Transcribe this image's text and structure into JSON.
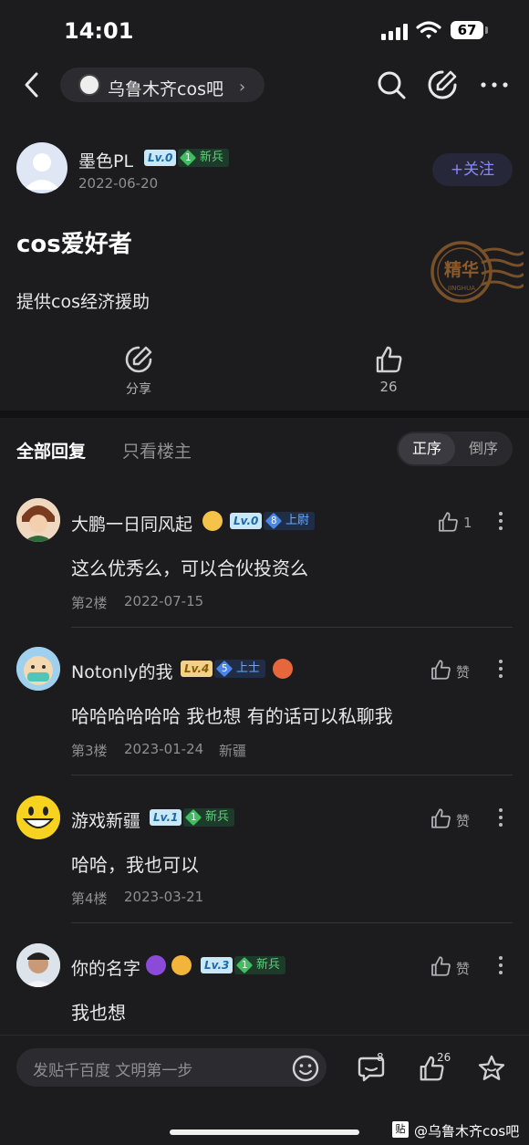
{
  "status_bar": {
    "time": "14:01",
    "battery": "67"
  },
  "nav": {
    "forum_name": "乌鲁木齐cos吧",
    "chevron": "›"
  },
  "post": {
    "author": "墨色PL",
    "level": "Lv.0",
    "rank_num": "1",
    "rank": "新兵",
    "date": "2022-06-20",
    "follow_label": "+关注",
    "title": "cos爱好者",
    "body": "提供cos经济援助",
    "stamp_text": "精华",
    "stamp_sub": "JINGHUA",
    "share_label": "分享",
    "like_count": "26"
  },
  "tabs": {
    "all": "全部回复",
    "op_only": "只看楼主",
    "asc": "正序",
    "desc": "倒序"
  },
  "comments": [
    {
      "name": "大鹏一日同风起",
      "level": "Lv.0",
      "rank_num": "8",
      "rank": "上尉",
      "text": "这么优秀么，可以合伙投资么",
      "floor": "第2楼",
      "date": "2022-07-15",
      "location": "",
      "likes": "1"
    },
    {
      "name": "Notonly的我",
      "level": "Lv.4",
      "rank_num": "5",
      "rank": "上士",
      "text": "哈哈哈哈哈哈 我也想 有的话可以私聊我",
      "floor": "第3楼",
      "date": "2023-01-24",
      "location": "新疆",
      "likes": "赞"
    },
    {
      "name": "游戏新疆",
      "level": "Lv.1",
      "rank_num": "1",
      "rank": "新兵",
      "text": "哈哈，我也可以",
      "floor": "第4楼",
      "date": "2023-03-21",
      "location": "",
      "likes": "赞"
    },
    {
      "name": "你的名字",
      "level": "Lv.3",
      "rank_num": "1",
      "rank": "新兵",
      "text": "我也想",
      "floor": "",
      "date": "",
      "location": "",
      "likes": "赞"
    }
  ],
  "bottom": {
    "placeholder": "发贴千百度 文明第一步",
    "comment_count": "8",
    "like_count": "26",
    "watermark_icon": "贴",
    "watermark": "@乌鲁木齐cos吧"
  },
  "colors": {
    "accent": "#8a86ff",
    "background": "#1c1c1e",
    "rank_green": "#5fd17a",
    "rank_blue": "#6aa8ff"
  }
}
